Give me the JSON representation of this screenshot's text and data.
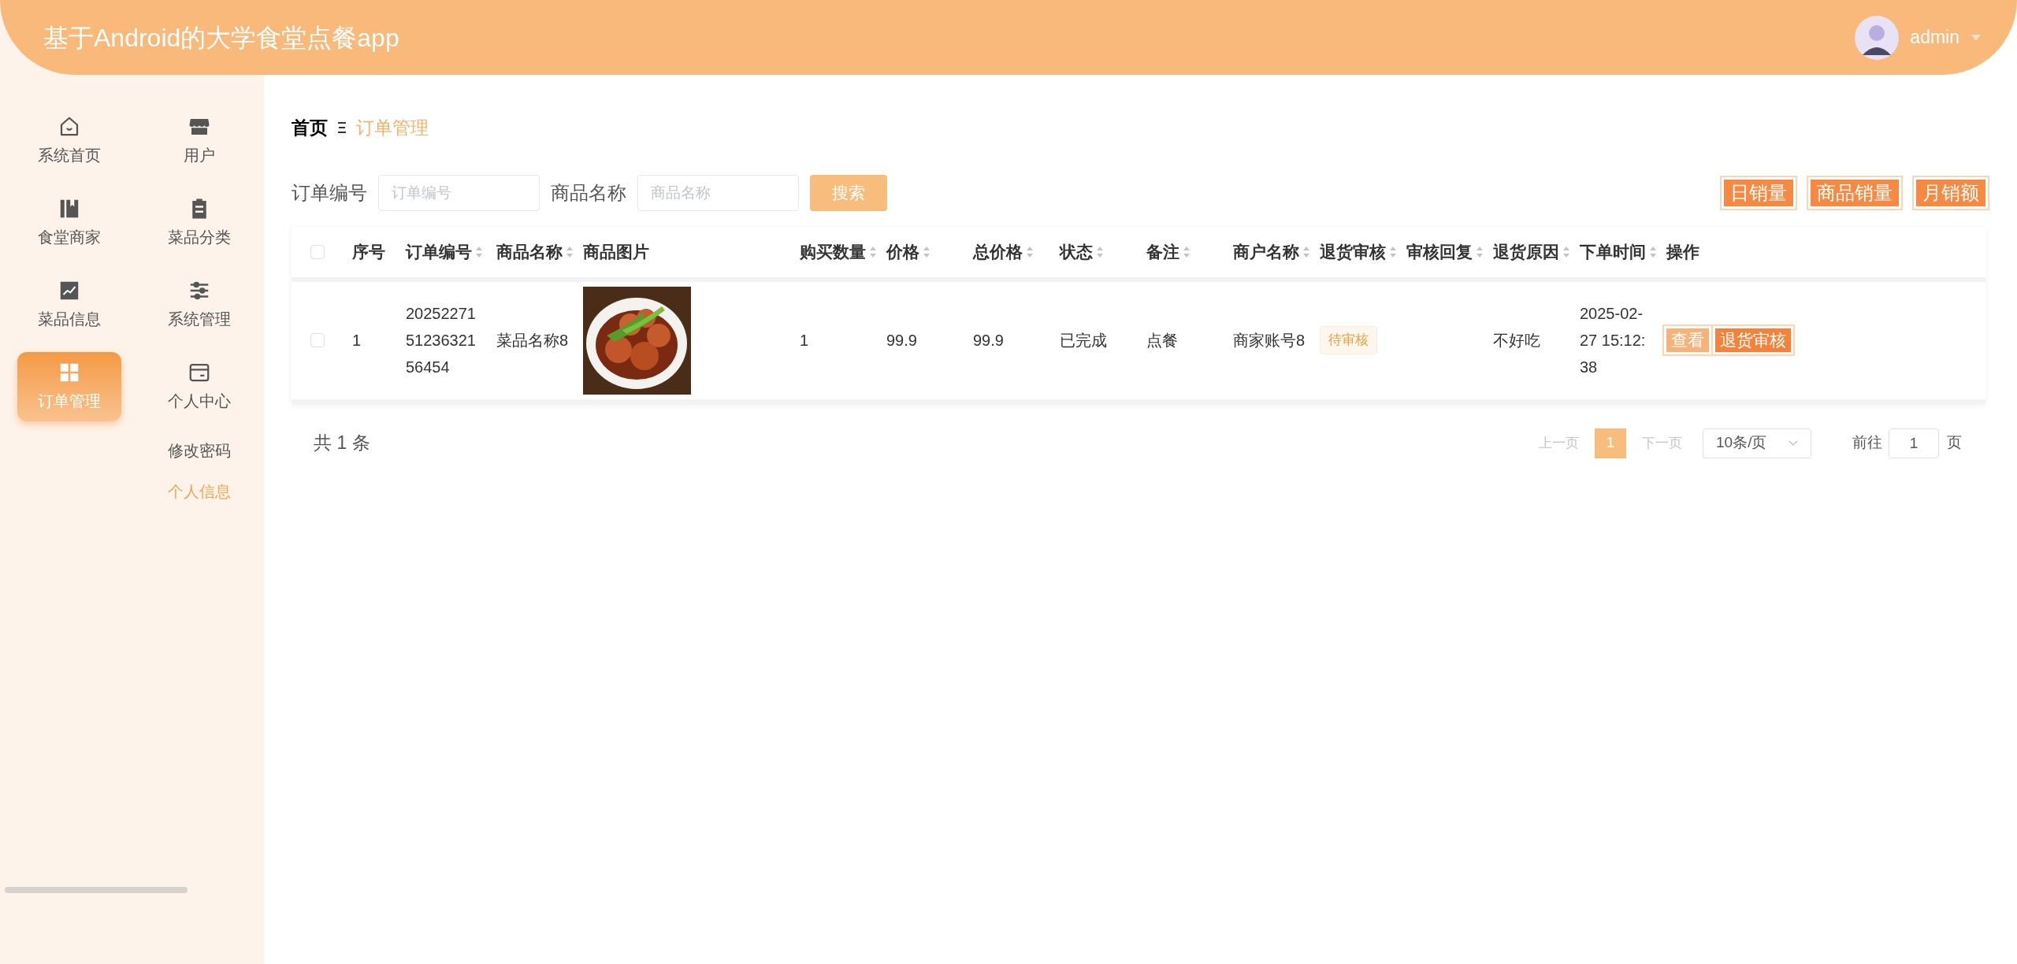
{
  "header": {
    "title": "基于Android的大学食堂点餐app",
    "user": {
      "name": "admin"
    }
  },
  "sidebar": {
    "items": [
      {
        "label": "系统首页",
        "selected": false
      },
      {
        "label": "用户",
        "selected": false
      },
      {
        "label": "食堂商家",
        "selected": false
      },
      {
        "label": "菜品分类",
        "selected": false
      },
      {
        "label": "菜品信息",
        "selected": false
      },
      {
        "label": "系统管理",
        "selected": false
      },
      {
        "label": "订单管理",
        "selected": true
      },
      {
        "label": "个人中心",
        "selected": false,
        "children": [
          {
            "label": "修改密码",
            "hovered": false
          },
          {
            "label": "个人信息",
            "hovered": true
          }
        ]
      }
    ]
  },
  "breadcrumb": [
    "首页",
    "订单管理"
  ],
  "search": {
    "fields": [
      {
        "label": "订单编号",
        "placeholder": "订单编号"
      },
      {
        "label": "商品名称",
        "placeholder": "商品名称"
      }
    ],
    "button": "搜索"
  },
  "chart_buttons": [
    "日销量",
    "商品销量",
    "月销额"
  ],
  "table": {
    "all_checked": false,
    "columns": [
      {
        "label": "序号",
        "sortable": false
      },
      {
        "label": "订单编号",
        "sortable": true
      },
      {
        "label": "商品名称",
        "sortable": true
      },
      {
        "label": "商品图片",
        "sortable": false
      },
      {
        "label": "购买数量",
        "sortable": true
      },
      {
        "label": "价格",
        "sortable": true
      },
      {
        "label": "总价格",
        "sortable": true
      },
      {
        "label": "状态",
        "sortable": true
      },
      {
        "label": "备注",
        "sortable": true
      },
      {
        "label": "商户名称",
        "sortable": true
      },
      {
        "label": "退货审核",
        "sortable": true
      },
      {
        "label": "审核回复",
        "sortable": true
      },
      {
        "label": "退货原因",
        "sortable": true
      },
      {
        "label": "下单时间",
        "sortable": true
      },
      {
        "label": "操作",
        "sortable": false
      }
    ],
    "rows": [
      {
        "checked": false,
        "cells": [
          {
            "kind": "text",
            "text": "1"
          },
          {
            "kind": "text",
            "text": "202522715123632156454"
          },
          {
            "kind": "text",
            "text": "菜品名称8"
          },
          {
            "kind": "picture"
          },
          {
            "kind": "text",
            "text": "1"
          },
          {
            "kind": "text",
            "text": "99.9"
          },
          {
            "kind": "text",
            "text": "99.9"
          },
          {
            "kind": "text",
            "text": "已完成"
          },
          {
            "kind": "text",
            "text": "点餐"
          },
          {
            "kind": "text",
            "text": "商家账号8"
          },
          {
            "kind": "badge",
            "text": "待审核"
          },
          {
            "kind": "empty"
          },
          {
            "kind": "text",
            "text": "不好吃"
          },
          {
            "kind": "text",
            "text": "2025-02-27 15:12:38"
          },
          {
            "kind": "actions",
            "buttons": [
              {
                "label": "查看",
                "kind": "view"
              },
              {
                "label": "退货审核",
                "kind": "review"
              }
            ]
          }
        ]
      }
    ]
  },
  "pagination": {
    "total": "共 1 条",
    "prev": {
      "label": "上一页",
      "disabled": true
    },
    "pages": [
      {
        "label": "1",
        "selected": true
      }
    ],
    "next": {
      "label": "下一页",
      "disabled": true
    },
    "page_size": "10条/页",
    "goto_label": "前往",
    "goto_value": "1",
    "page_unit": "页"
  }
}
